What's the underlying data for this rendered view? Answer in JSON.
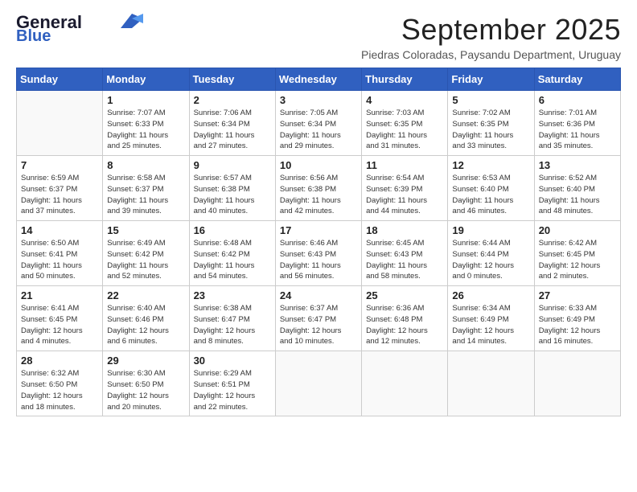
{
  "header": {
    "logo_line1": "General",
    "logo_line2": "Blue",
    "month": "September 2025",
    "location": "Piedras Coloradas, Paysandu Department, Uruguay"
  },
  "weekdays": [
    "Sunday",
    "Monday",
    "Tuesday",
    "Wednesday",
    "Thursday",
    "Friday",
    "Saturday"
  ],
  "weeks": [
    [
      {
        "day": "",
        "info": ""
      },
      {
        "day": "1",
        "info": "Sunrise: 7:07 AM\nSunset: 6:33 PM\nDaylight: 11 hours\nand 25 minutes."
      },
      {
        "day": "2",
        "info": "Sunrise: 7:06 AM\nSunset: 6:34 PM\nDaylight: 11 hours\nand 27 minutes."
      },
      {
        "day": "3",
        "info": "Sunrise: 7:05 AM\nSunset: 6:34 PM\nDaylight: 11 hours\nand 29 minutes."
      },
      {
        "day": "4",
        "info": "Sunrise: 7:03 AM\nSunset: 6:35 PM\nDaylight: 11 hours\nand 31 minutes."
      },
      {
        "day": "5",
        "info": "Sunrise: 7:02 AM\nSunset: 6:35 PM\nDaylight: 11 hours\nand 33 minutes."
      },
      {
        "day": "6",
        "info": "Sunrise: 7:01 AM\nSunset: 6:36 PM\nDaylight: 11 hours\nand 35 minutes."
      }
    ],
    [
      {
        "day": "7",
        "info": "Sunrise: 6:59 AM\nSunset: 6:37 PM\nDaylight: 11 hours\nand 37 minutes."
      },
      {
        "day": "8",
        "info": "Sunrise: 6:58 AM\nSunset: 6:37 PM\nDaylight: 11 hours\nand 39 minutes."
      },
      {
        "day": "9",
        "info": "Sunrise: 6:57 AM\nSunset: 6:38 PM\nDaylight: 11 hours\nand 40 minutes."
      },
      {
        "day": "10",
        "info": "Sunrise: 6:56 AM\nSunset: 6:38 PM\nDaylight: 11 hours\nand 42 minutes."
      },
      {
        "day": "11",
        "info": "Sunrise: 6:54 AM\nSunset: 6:39 PM\nDaylight: 11 hours\nand 44 minutes."
      },
      {
        "day": "12",
        "info": "Sunrise: 6:53 AM\nSunset: 6:40 PM\nDaylight: 11 hours\nand 46 minutes."
      },
      {
        "day": "13",
        "info": "Sunrise: 6:52 AM\nSunset: 6:40 PM\nDaylight: 11 hours\nand 48 minutes."
      }
    ],
    [
      {
        "day": "14",
        "info": "Sunrise: 6:50 AM\nSunset: 6:41 PM\nDaylight: 11 hours\nand 50 minutes."
      },
      {
        "day": "15",
        "info": "Sunrise: 6:49 AM\nSunset: 6:42 PM\nDaylight: 11 hours\nand 52 minutes."
      },
      {
        "day": "16",
        "info": "Sunrise: 6:48 AM\nSunset: 6:42 PM\nDaylight: 11 hours\nand 54 minutes."
      },
      {
        "day": "17",
        "info": "Sunrise: 6:46 AM\nSunset: 6:43 PM\nDaylight: 11 hours\nand 56 minutes."
      },
      {
        "day": "18",
        "info": "Sunrise: 6:45 AM\nSunset: 6:43 PM\nDaylight: 11 hours\nand 58 minutes."
      },
      {
        "day": "19",
        "info": "Sunrise: 6:44 AM\nSunset: 6:44 PM\nDaylight: 12 hours\nand 0 minutes."
      },
      {
        "day": "20",
        "info": "Sunrise: 6:42 AM\nSunset: 6:45 PM\nDaylight: 12 hours\nand 2 minutes."
      }
    ],
    [
      {
        "day": "21",
        "info": "Sunrise: 6:41 AM\nSunset: 6:45 PM\nDaylight: 12 hours\nand 4 minutes."
      },
      {
        "day": "22",
        "info": "Sunrise: 6:40 AM\nSunset: 6:46 PM\nDaylight: 12 hours\nand 6 minutes."
      },
      {
        "day": "23",
        "info": "Sunrise: 6:38 AM\nSunset: 6:47 PM\nDaylight: 12 hours\nand 8 minutes."
      },
      {
        "day": "24",
        "info": "Sunrise: 6:37 AM\nSunset: 6:47 PM\nDaylight: 12 hours\nand 10 minutes."
      },
      {
        "day": "25",
        "info": "Sunrise: 6:36 AM\nSunset: 6:48 PM\nDaylight: 12 hours\nand 12 minutes."
      },
      {
        "day": "26",
        "info": "Sunrise: 6:34 AM\nSunset: 6:49 PM\nDaylight: 12 hours\nand 14 minutes."
      },
      {
        "day": "27",
        "info": "Sunrise: 6:33 AM\nSunset: 6:49 PM\nDaylight: 12 hours\nand 16 minutes."
      }
    ],
    [
      {
        "day": "28",
        "info": "Sunrise: 6:32 AM\nSunset: 6:50 PM\nDaylight: 12 hours\nand 18 minutes."
      },
      {
        "day": "29",
        "info": "Sunrise: 6:30 AM\nSunset: 6:50 PM\nDaylight: 12 hours\nand 20 minutes."
      },
      {
        "day": "30",
        "info": "Sunrise: 6:29 AM\nSunset: 6:51 PM\nDaylight: 12 hours\nand 22 minutes."
      },
      {
        "day": "",
        "info": ""
      },
      {
        "day": "",
        "info": ""
      },
      {
        "day": "",
        "info": ""
      },
      {
        "day": "",
        "info": ""
      }
    ]
  ]
}
